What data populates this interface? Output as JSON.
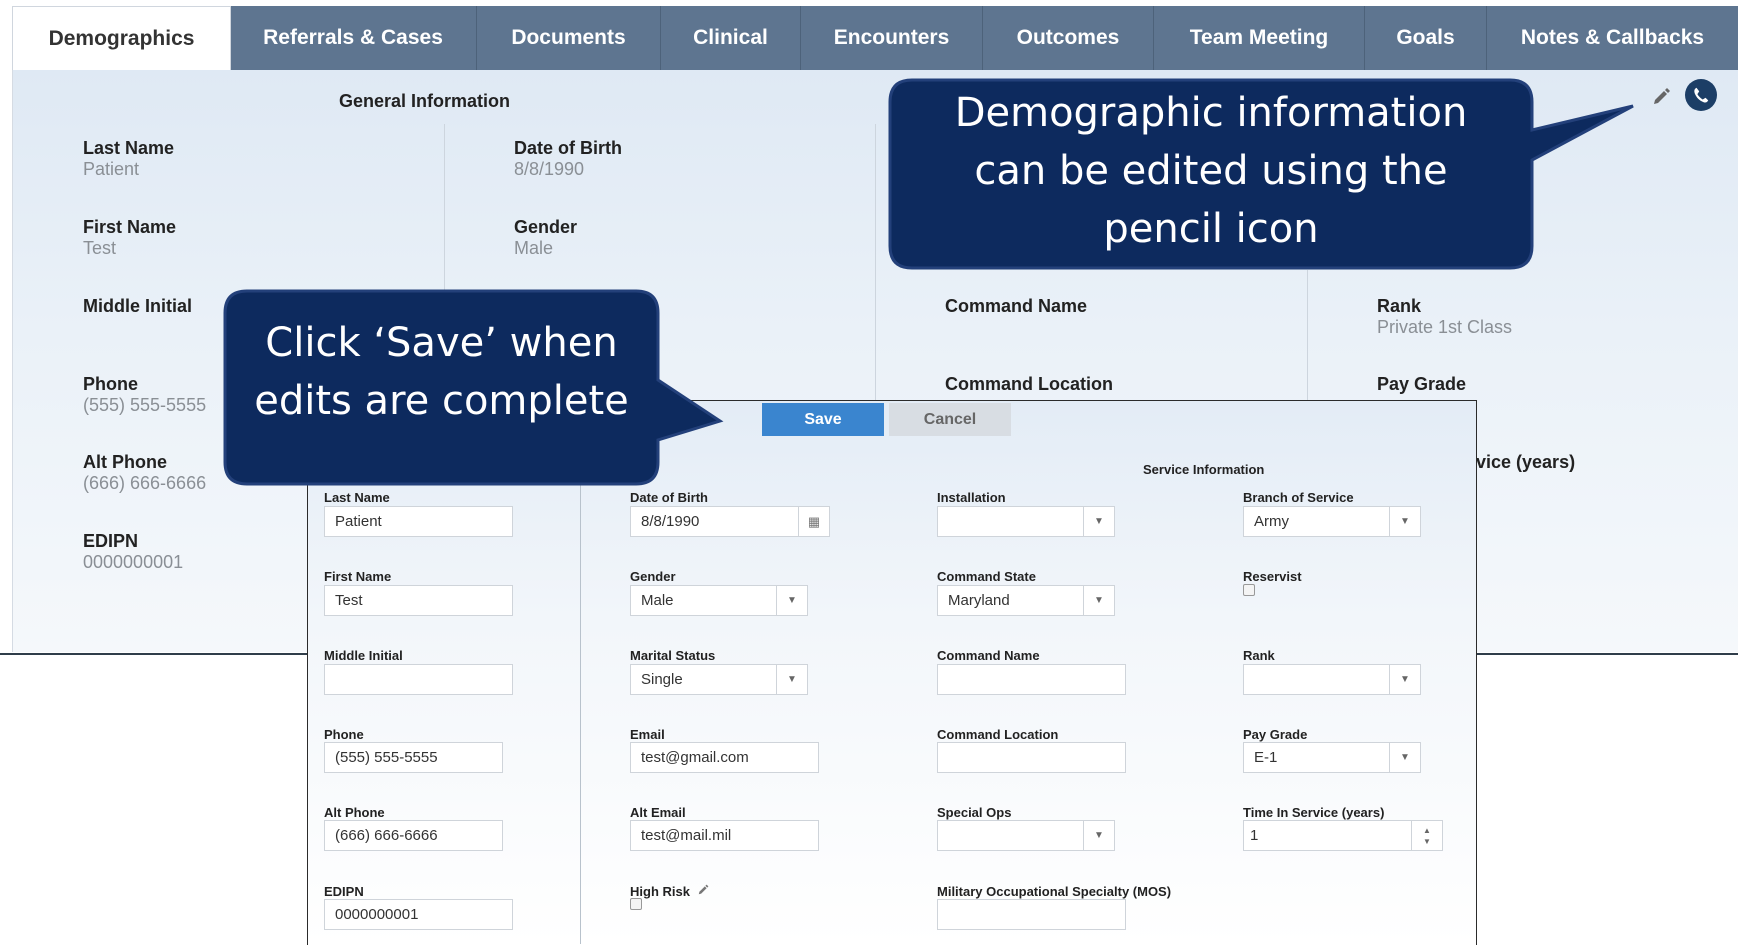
{
  "tabs": [
    {
      "label": "Demographics",
      "active": true
    },
    {
      "label": "Referrals & Cases"
    },
    {
      "label": "Documents"
    },
    {
      "label": "Clinical"
    },
    {
      "label": "Encounters"
    },
    {
      "label": "Outcomes"
    },
    {
      "label": "Team Meeting"
    },
    {
      "label": "Goals"
    },
    {
      "label": "Notes & Callbacks"
    }
  ],
  "general": {
    "title": "General Information",
    "last_name_label": "Last Name",
    "last_name": "Patient",
    "first_name_label": "First Name",
    "first_name": "Test",
    "middle_initial_label": "Middle Initial",
    "phone_label": "Phone",
    "phone": "(555) 555-5555",
    "alt_phone_label": "Alt Phone",
    "alt_phone": "(666) 666-6666",
    "edipn_label": "EDIPN",
    "edipn": "0000000001",
    "dob_label": "Date of Birth",
    "dob": "8/8/1990",
    "gender_label": "Gender",
    "gender": "Male"
  },
  "service": {
    "command_name_label": "Command Name",
    "command_location_label": "Command Location",
    "rank_label": "Rank",
    "rank": "Private 1st Class",
    "pay_grade_label": "Pay Grade",
    "time_in_service_partial": "vice (years)"
  },
  "form": {
    "save_label": "Save",
    "cancel_label": "Cancel",
    "service_title": "Service Information",
    "last_name_label": "Last Name",
    "last_name": "Patient",
    "first_name_label": "First Name",
    "first_name": "Test",
    "middle_initial_label": "Middle Initial",
    "middle_initial": "",
    "phone_label": "Phone",
    "phone": "(555) 555-5555",
    "alt_phone_label": "Alt Phone",
    "alt_phone": "(666) 666-6666",
    "edipn_label": "EDIPN",
    "edipn": "0000000001",
    "dob_label": "Date of Birth",
    "dob": "8/8/1990",
    "gender_label": "Gender",
    "gender": "Male",
    "marital_label": "Marital Status",
    "marital": "Single",
    "email_label": "Email",
    "email": "test@gmail.com",
    "alt_email_label": "Alt Email",
    "alt_email": "test@mail.mil",
    "high_risk_label": "High Risk",
    "installation_label": "Installation",
    "installation": "",
    "command_state_label": "Command State",
    "command_state": "Maryland",
    "command_name_label": "Command Name",
    "command_name": "",
    "command_location_label": "Command Location",
    "command_location": "",
    "special_ops_label": "Special Ops",
    "special_ops": "",
    "mos_label": "Military Occupational Specialty (MOS)",
    "mos": "",
    "branch_label": "Branch of Service",
    "branch": "Army",
    "reservist_label": "Reservist",
    "rank_label": "Rank",
    "rank": "",
    "pay_grade_label": "Pay Grade",
    "pay_grade": "E-1",
    "time_in_service_label": "Time In Service (years)",
    "time_in_service": "1"
  },
  "callouts": {
    "top_line1": "Demographic information",
    "top_line2": "can be edited using the",
    "top_line3": "pencil icon",
    "left_line1": "Click ‘Save’ when",
    "left_line2": "edits are complete"
  },
  "icons": {
    "pencil": "pencil-icon",
    "phone": "phone-icon",
    "calendar": "calendar-icon",
    "dropdown": "chevron-down-icon"
  },
  "colors": {
    "tab_bar": "#5e7590",
    "save_button": "#3a85cf",
    "callout_fill": "#0d2a5e",
    "phone_button": "#1c3e66"
  }
}
